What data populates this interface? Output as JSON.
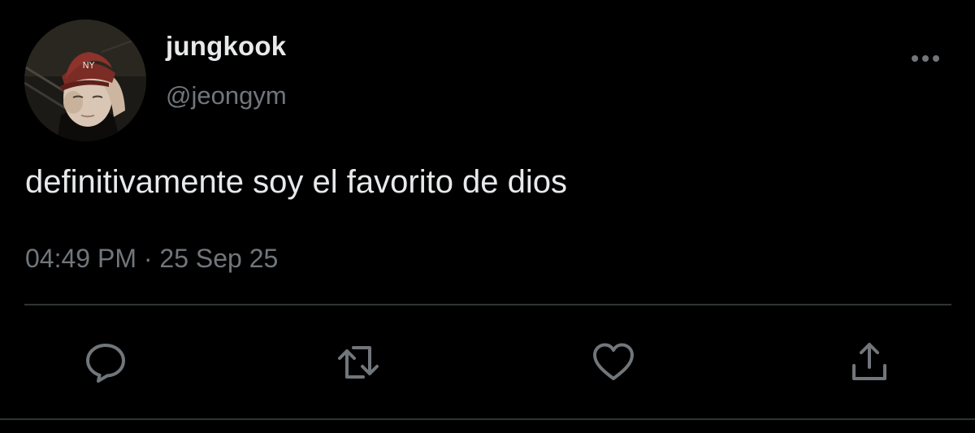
{
  "tweet": {
    "author": {
      "display_name": "jungkook",
      "handle": "@jeongym",
      "avatar": "profile-photo"
    },
    "text": "definitivamente soy el favorito de dios",
    "time": "04:49 PM",
    "separator": "·",
    "date": "25 Sep 25"
  },
  "actions": [
    {
      "name": "reply",
      "icon": "reply-icon"
    },
    {
      "name": "retweet",
      "icon": "retweet-icon"
    },
    {
      "name": "like",
      "icon": "heart-icon"
    },
    {
      "name": "share",
      "icon": "share-icon"
    }
  ],
  "colors": {
    "background": "#000000",
    "text_primary": "#e7e9ea",
    "text_secondary": "#71767b",
    "divider": "#2f3336"
  }
}
